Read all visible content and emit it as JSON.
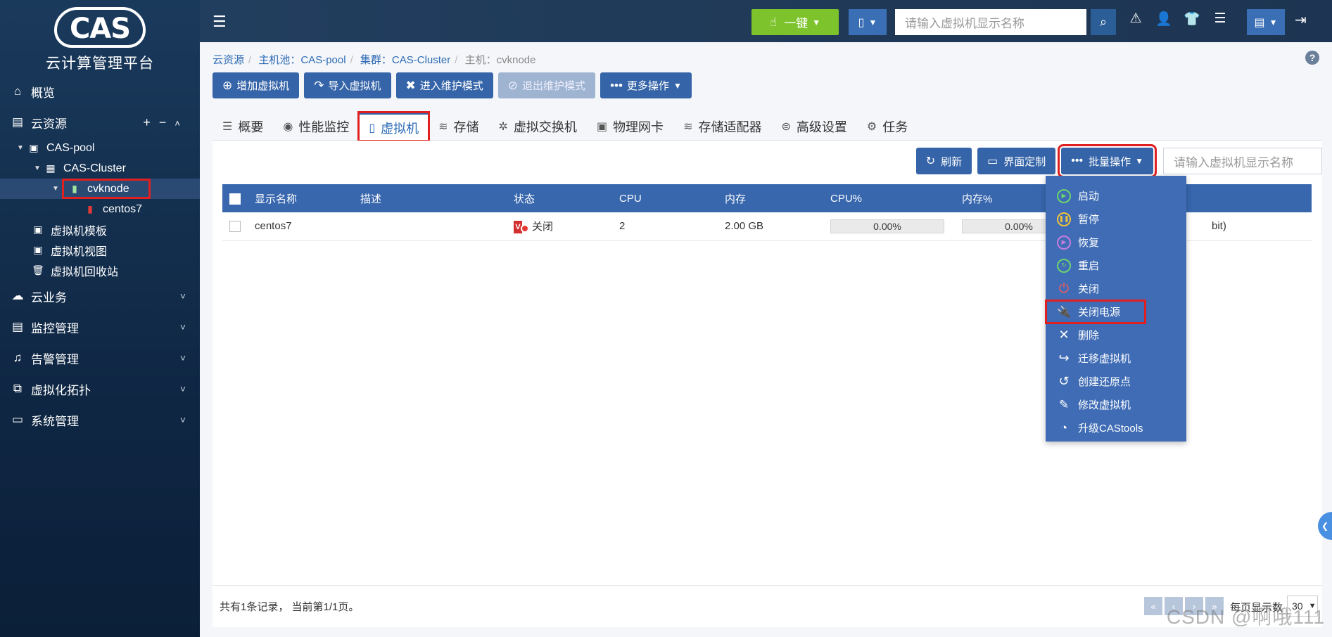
{
  "app": {
    "logo_text": "CAS",
    "platform_name": "云计算管理平台"
  },
  "sidebar": {
    "overview": "概览",
    "cloud_resources": "云资源",
    "pool": "CAS-pool",
    "cluster": "CAS-Cluster",
    "host": "cvknode",
    "vm": "centos7",
    "vm_template": "虚拟机模板",
    "vm_view": "虚拟机视图",
    "vm_recycle": "虚拟机回收站",
    "cloud_business": "云业务",
    "monitor": "监控管理",
    "alarm": "告警管理",
    "topology": "虚拟化拓扑",
    "system": "系统管理"
  },
  "topbar": {
    "onekey_label": "一键",
    "search_placeholder": "请输入虚拟机显示名称"
  },
  "breadcrumb": {
    "root": "云资源",
    "pool": "主机池：CAS-pool",
    "cluster": "集群：CAS-Cluster",
    "host": "主机：cvknode"
  },
  "toolbar": {
    "add_vm": "增加虚拟机",
    "import_vm": "导入虚拟机",
    "enter_maint": "进入维护模式",
    "exit_maint": "退出维护模式",
    "more_ops": "更多操作"
  },
  "tabs": [
    "概要",
    "性能监控",
    "虚拟机",
    "存储",
    "虚拟交换机",
    "物理网卡",
    "存储适配器",
    "高级设置",
    "任务"
  ],
  "content_toolbar": {
    "refresh": "刷新",
    "customize": "界面定制",
    "batch": "批量操作",
    "search_placeholder": "请输入虚拟机显示名称"
  },
  "table": {
    "headers": [
      "显示名称",
      "描述",
      "状态",
      "CPU",
      "内存",
      "CPU%",
      "内存%"
    ],
    "rows": [
      {
        "name": "centos7",
        "desc": "",
        "status": "关闭",
        "cpu": "2",
        "memory": "2.00 GB",
        "cpu_pct": "0.00%",
        "mem_pct": "0.00%",
        "tail": "bit)"
      }
    ]
  },
  "pager": {
    "summary": "共有1条记录， 当前第1/1页。",
    "per_page_label": "每页显示数",
    "per_page_value": "30"
  },
  "batch_menu": [
    "启动",
    "暂停",
    "恢复",
    "重启",
    "关闭",
    "关闭电源",
    "删除",
    "迁移虚拟机",
    "创建还原点",
    "修改虚拟机",
    "升级CAStools"
  ],
  "watermark": "CSDN @啊哦111"
}
